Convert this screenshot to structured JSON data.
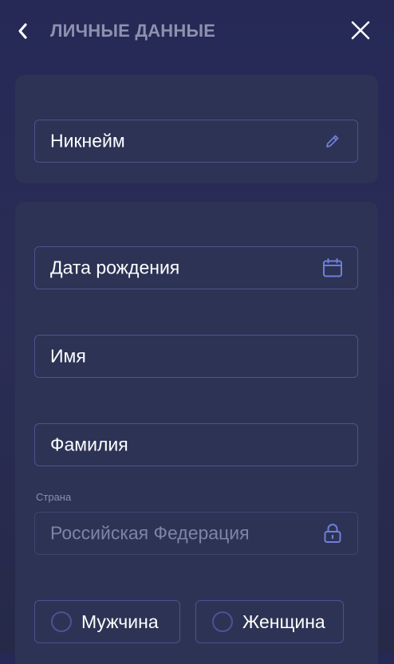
{
  "header": {
    "title": "ЛИЧНЫЕ ДАННЫЕ",
    "back_icon": "chevron-left-icon",
    "close_icon": "close-icon"
  },
  "nickname_field": {
    "value": "Никнейм",
    "icon": "pencil-icon"
  },
  "birthdate_field": {
    "value": "Дата рождения",
    "icon": "calendar-icon"
  },
  "first_name_field": {
    "value": "Имя"
  },
  "last_name_field": {
    "value": "Фамилия"
  },
  "country": {
    "label": "Страна",
    "value": "Российская Федерация",
    "icon": "lock-icon",
    "disabled": true
  },
  "gender": {
    "options": [
      {
        "label": "Мужчина",
        "selected": false
      },
      {
        "label": "Женщина",
        "selected": false
      }
    ]
  },
  "colors": {
    "accent": "#6f7fd9",
    "field_border": "#4b5394",
    "card_bg": "#2d3354",
    "title": "#8e91ae"
  }
}
